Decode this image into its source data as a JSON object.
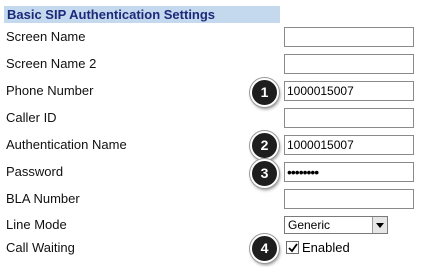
{
  "section": {
    "title": "Basic SIP Authentication Settings"
  },
  "fields": [
    {
      "label": "Screen Name",
      "value": ""
    },
    {
      "label": "Screen Name 2",
      "value": ""
    },
    {
      "label": "Phone Number",
      "value": "1000015007"
    },
    {
      "label": "Caller ID",
      "value": ""
    },
    {
      "label": "Authentication Name",
      "value": "1000015007"
    },
    {
      "label": "Password",
      "value": "••••••••"
    },
    {
      "label": "BLA Number",
      "value": ""
    },
    {
      "label": "Line Mode",
      "value": "Generic"
    },
    {
      "label": "Call Waiting",
      "value": "Enabled",
      "checked": true
    }
  ],
  "markers": [
    "1",
    "2",
    "3",
    "4"
  ],
  "colors": {
    "header_bg": "#c5d9ee",
    "header_text": "#1c2a7a",
    "marker_bg": "#1e1e1e"
  }
}
